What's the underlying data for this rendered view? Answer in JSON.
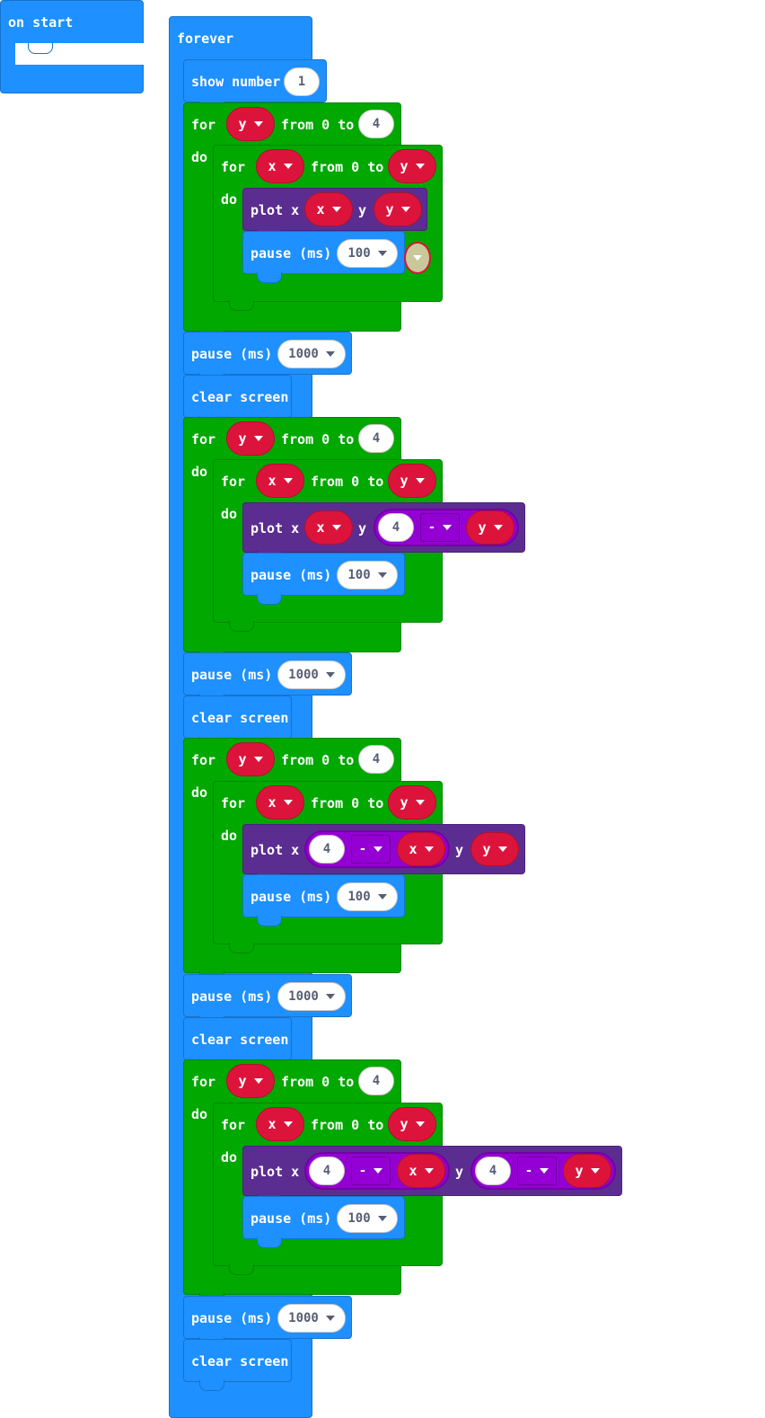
{
  "on_start": {
    "label": "on start"
  },
  "forever": {
    "label": "forever"
  },
  "show_number": {
    "label": "show number",
    "value": "1"
  },
  "keywords": {
    "for": "for",
    "do": "do",
    "from_0_to": "from 0 to",
    "plot_x": "plot x",
    "y": "y",
    "pause_ms": "pause (ms)",
    "clear_screen": "clear screen"
  },
  "vars": {
    "y": "y",
    "x": "x"
  },
  "numbers": {
    "outer_limit": "4",
    "four": "4",
    "inner_pause": "100",
    "outer_pause": "1000"
  },
  "operator": "-",
  "colors": {
    "basic": "#1E90FF",
    "loops": "#00A800",
    "led": "#5C2D91",
    "variables": "#DC143C",
    "math": "#9400D3"
  },
  "icons": [
    "dropdown-arrow-icon"
  ]
}
